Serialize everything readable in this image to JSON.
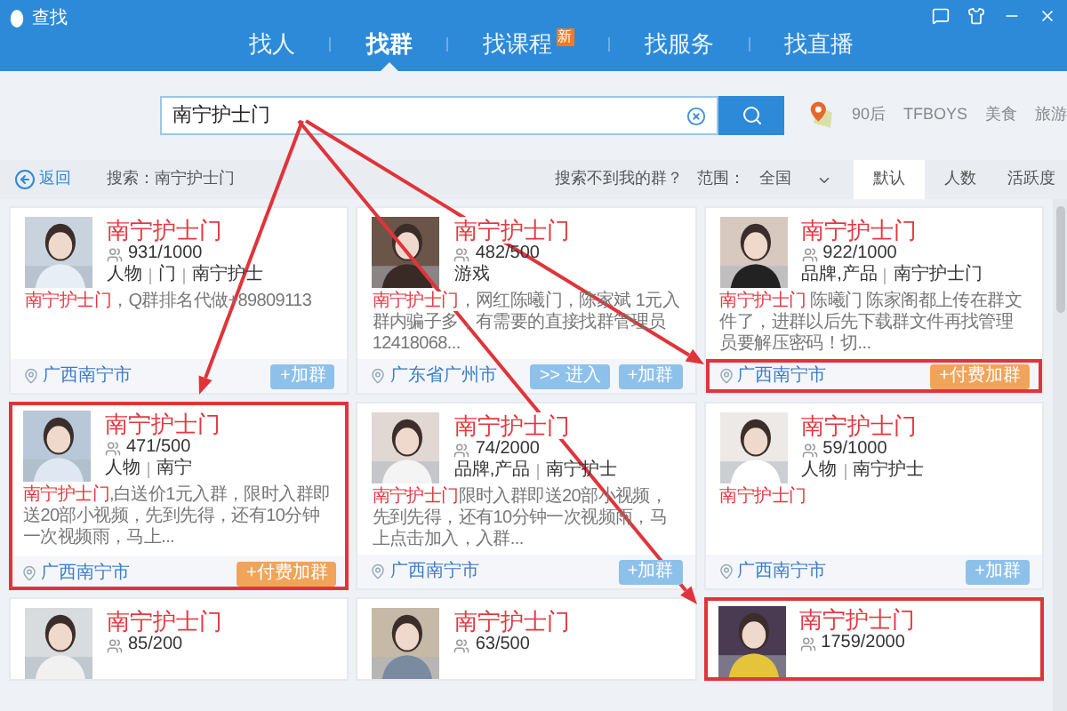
{
  "window": {
    "title": "查找"
  },
  "nav": [
    {
      "label": "找人",
      "selected": false
    },
    {
      "label": "找群",
      "selected": true
    },
    {
      "label": "找课程",
      "selected": false,
      "badge": "新"
    },
    {
      "label": "找服务",
      "selected": false
    },
    {
      "label": "找直播",
      "selected": false
    }
  ],
  "search": {
    "value": "南宁护士门",
    "hot_tags": [
      "90后",
      "TFBOYS",
      "美食",
      "旅游"
    ]
  },
  "toolbar": {
    "back": "返回",
    "query": "搜索：南宁护士门",
    "help_link": "搜索不到我的群？",
    "scope_label": "范围：",
    "scope": "全国",
    "sort_tabs": [
      {
        "label": "默认",
        "selected": true
      },
      {
        "label": "人数",
        "selected": false
      },
      {
        "label": "活跃度",
        "selected": false
      }
    ]
  },
  "groups": [
    {
      "name": "南宁护士门",
      "members": "931/1000",
      "tags": [
        "人物",
        "门",
        "南宁护士"
      ],
      "desc_highlight": "南宁护士门",
      "desc": "，Q群排名代做+89809113",
      "location": "广西南宁市",
      "buttons": [
        {
          "label": "+加群",
          "kind": "join"
        }
      ],
      "highlighted": false,
      "footer_highlighted": false
    },
    {
      "name": "南宁护士门",
      "members": "482/500",
      "tags": [
        "游戏"
      ],
      "desc_highlight": "南宁护士门",
      "desc": "，网红陈曦门，陈家斌 1元入群内骗子多，有需要的直接找群管理员 12418068...",
      "location": "广东省广州市",
      "buttons": [
        {
          "label": ">> 进入",
          "kind": "enter"
        },
        {
          "label": "+加群",
          "kind": "join"
        }
      ],
      "highlighted": false,
      "footer_highlighted": false
    },
    {
      "name": "南宁护士门",
      "members": "922/1000",
      "tags": [
        "品牌,产品",
        "南宁护士门"
      ],
      "desc_highlight": "南宁护士门",
      "desc": " 陈曦门 陈家阁都上传在群文件了，进群以后先下载群文件再找管理员要解压密码！切...",
      "location": "广西南宁市",
      "buttons": [
        {
          "label": "+付费加群",
          "kind": "paid"
        }
      ],
      "highlighted": false,
      "footer_highlighted": true
    },
    {
      "name": "南宁护士门",
      "members": "471/500",
      "tags": [
        "人物",
        "南宁"
      ],
      "desc_highlight": "南宁护士门",
      "desc": ",白送价1元入群，限时入群即送20部小视频，先到先得，还有10分钟一次视频雨，马上...",
      "location": "广西南宁市",
      "buttons": [
        {
          "label": "+付费加群",
          "kind": "paid"
        }
      ],
      "highlighted": true,
      "footer_highlighted": false
    },
    {
      "name": "南宁护士门",
      "members": "74/2000",
      "tags": [
        "品牌,产品",
        "南宁护士"
      ],
      "desc_highlight": "南宁护士门",
      "desc": "限时入群即送20部小视频，先到先得，还有10分钟一次视频雨，马上点击加入，入群...",
      "location": "广西南宁市",
      "buttons": [
        {
          "label": "+加群",
          "kind": "join"
        }
      ],
      "highlighted": false,
      "footer_highlighted": false
    },
    {
      "name": "南宁护士门",
      "members": "59/1000",
      "tags": [
        "人物",
        "南宁护士"
      ],
      "desc_highlight": "南宁护士门",
      "location": "广西南宁市",
      "buttons": [
        {
          "label": "+加群",
          "kind": "join"
        }
      ],
      "highlighted": false,
      "footer_highlighted": false
    },
    {
      "name": "南宁护士门",
      "members": "85/200",
      "highlighted": false
    },
    {
      "name": "南宁护士门",
      "members": "63/500",
      "highlighted": false
    },
    {
      "name": "南宁护士门",
      "members": "1759/2000",
      "highlighted": true
    }
  ]
}
